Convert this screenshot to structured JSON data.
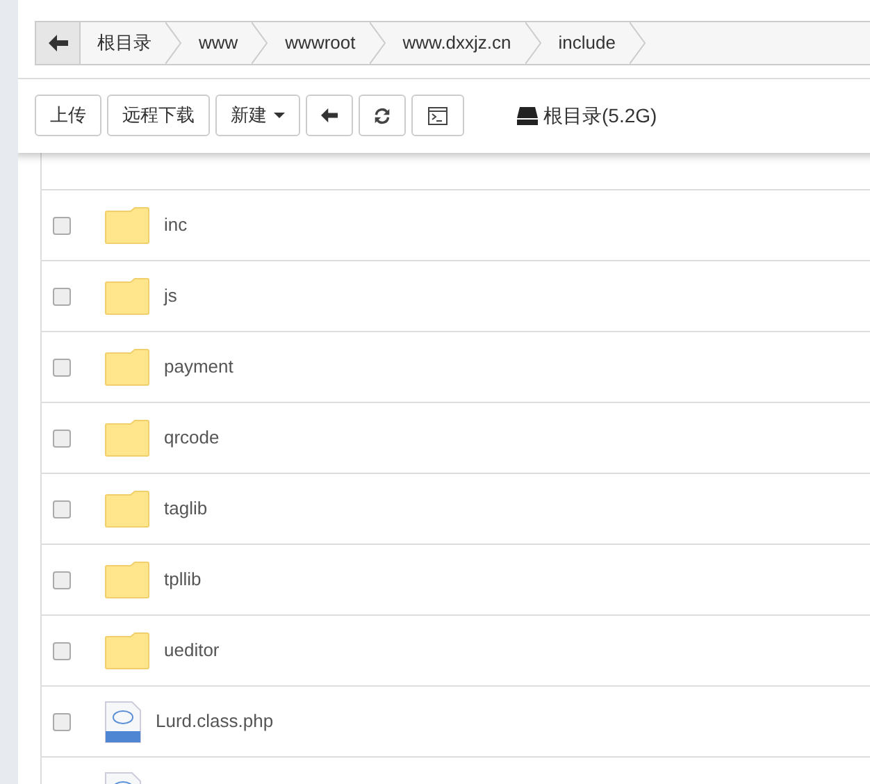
{
  "breadcrumb": {
    "items": [
      "根目录",
      "www",
      "wwwroot",
      "www.dxxjz.cn",
      "include"
    ]
  },
  "toolbar": {
    "buttons": [
      {
        "kind": "text",
        "label": "上传"
      },
      {
        "kind": "text",
        "label": "远程下载"
      },
      {
        "kind": "dropdown",
        "label": "新建"
      },
      {
        "kind": "back"
      },
      {
        "kind": "refresh"
      },
      {
        "kind": "terminal"
      }
    ],
    "disk": "根目录(5.2G)"
  },
  "files": [
    {
      "kind": "folder",
      "name": "inc",
      "checked": false
    },
    {
      "kind": "folder",
      "name": "js",
      "checked": false
    },
    {
      "kind": "folder",
      "name": "payment",
      "checked": false
    },
    {
      "kind": "folder",
      "name": "qrcode",
      "checked": false
    },
    {
      "kind": "folder",
      "name": "taglib",
      "checked": false
    },
    {
      "kind": "folder",
      "name": "tpllib",
      "checked": false
    },
    {
      "kind": "folder",
      "name": "ueditor",
      "checked": false
    },
    {
      "kind": "php",
      "name": "Lurd.class.php",
      "checked": false
    },
    {
      "kind": "php"
    }
  ]
}
